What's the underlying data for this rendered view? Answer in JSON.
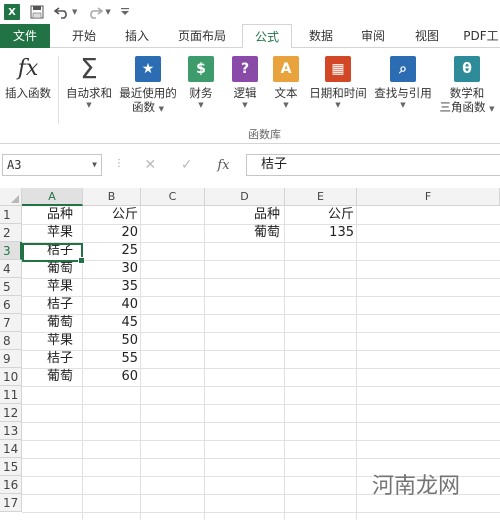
{
  "quick_access": {
    "app_logo": "X",
    "icons": [
      "excel-logo",
      "save-icon",
      "undo-icon",
      "redo-icon",
      "customize-icon"
    ]
  },
  "tabs": [
    {
      "label": "文件"
    },
    {
      "label": "开始"
    },
    {
      "label": "插入"
    },
    {
      "label": "页面布局"
    },
    {
      "label": "公式"
    },
    {
      "label": "数据"
    },
    {
      "label": "审阅"
    },
    {
      "label": "视图"
    },
    {
      "label": "PDF工"
    }
  ],
  "ribbon": {
    "insert_function": "插入函数",
    "autosum": "自动求和",
    "recent_line1": "最近使用的",
    "recent_line2": "函数",
    "financial": "财务",
    "logical": "逻辑",
    "text": "文本",
    "datetime": "日期和时间",
    "lookup": "查找与引用",
    "math_line1": "数学和",
    "math_line2": "三角函数",
    "group_label": "函数库",
    "colors": {
      "blue": "#2b6cb3",
      "green": "#3e9b6c",
      "purple": "#8a4aa8",
      "orange": "#e8a33c",
      "red": "#d24726",
      "teal": "#2e8b9a",
      "accent": "#217346"
    }
  },
  "formula_bar": {
    "name_box": "A3",
    "content": "桔子",
    "cancel": "✕",
    "enter": "✓",
    "fx": "fx"
  },
  "grid": {
    "columns": [
      "A",
      "B",
      "C",
      "D",
      "E",
      "F"
    ],
    "rows": [
      "1",
      "2",
      "3",
      "4",
      "5",
      "6",
      "7",
      "8",
      "9",
      "10",
      "11",
      "12",
      "13",
      "14",
      "15",
      "16",
      "17"
    ],
    "A": [
      "品种",
      "苹果",
      "桔子",
      "葡萄",
      "苹果",
      "桔子",
      "葡萄",
      "苹果",
      "桔子",
      "葡萄"
    ],
    "B": [
      "公斤",
      "20",
      "25",
      "30",
      "35",
      "40",
      "45",
      "50",
      "55",
      "60"
    ],
    "D": [
      "品种",
      "葡萄"
    ],
    "E": [
      "公斤",
      "135"
    ]
  },
  "watermark": "河南龙网"
}
